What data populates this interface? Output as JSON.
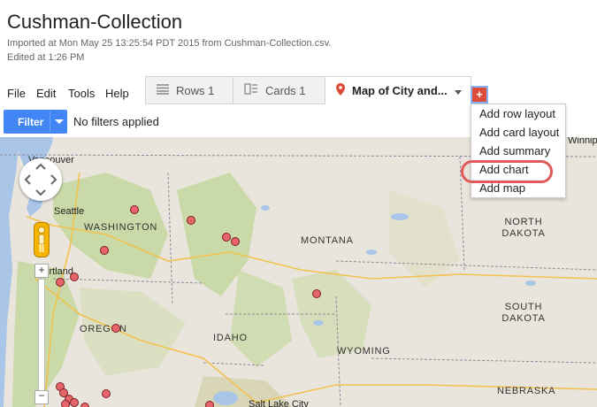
{
  "header": {
    "title": "Cushman-Collection",
    "imported_line": "Imported at Mon May 25 13:25:54 PDT 2015 from Cushman-Collection.csv.",
    "edited_line": "Edited at 1:26 PM"
  },
  "menu": [
    "File",
    "Edit",
    "Tools",
    "Help"
  ],
  "tabs": [
    {
      "label": "Rows 1",
      "icon": "rows-icon"
    },
    {
      "label": "Cards 1",
      "icon": "cards-icon"
    },
    {
      "label": "Map of City and...",
      "icon": "map-pin-icon"
    }
  ],
  "add_tab_symbol": "+",
  "filter": {
    "button_label": "Filter",
    "status": "No filters applied"
  },
  "dropdown": {
    "items": [
      "Add row layout",
      "Add card layout",
      "Add summary",
      "Add chart",
      "Add map"
    ],
    "highlighted": "Add chart"
  },
  "map": {
    "states": [
      "WASHINGTON",
      "MONTANA",
      "OREGON",
      "IDAHO",
      "WYOMING",
      "NORTH DAKOTA",
      "SOUTH DAKOTA",
      "NEBRASKA"
    ],
    "cities": [
      "Vancouver",
      "Seattle",
      "Portland",
      "Salt Lake City"
    ],
    "partial_labels": [
      "Winnipeg"
    ],
    "zoom": {
      "plus": "+",
      "minus": "−"
    },
    "colors": {
      "marker": "#e8646b",
      "marker_outline": "#7a1f24",
      "land": "#e9e5dc",
      "forest": "#c9d9a8",
      "water": "#a9c6e8"
    }
  }
}
